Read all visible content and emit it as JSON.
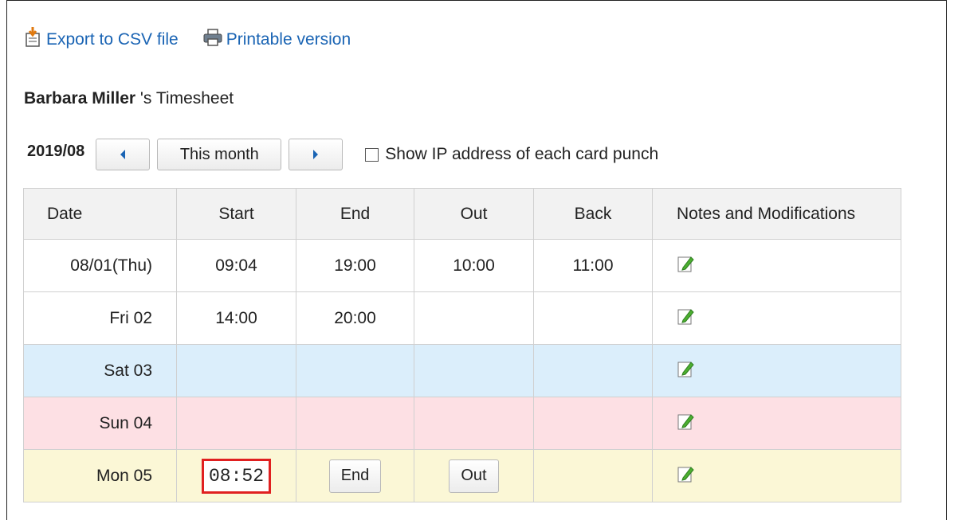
{
  "toolbar": {
    "export_label": "Export to CSV file",
    "print_label": "Printable version"
  },
  "heading": {
    "user": "Barbara Miller",
    "suffix": " 's Timesheet"
  },
  "nav": {
    "month": "2019/08",
    "this_month_label": "This month",
    "show_ip_label": "Show IP address of each card punch"
  },
  "table": {
    "headers": [
      "Date",
      "Start",
      "End",
      "Out",
      "Back",
      "Notes and Modifications"
    ],
    "rows": [
      {
        "date": "08/01(Thu)",
        "start": "09:04",
        "end": "19:00",
        "out": "10:00",
        "back": "11:00"
      },
      {
        "date": "Fri 02",
        "start": "14:00",
        "end": "20:00",
        "out": "",
        "back": ""
      },
      {
        "date": "Sat 03",
        "start": "",
        "end": "",
        "out": "",
        "back": ""
      },
      {
        "date": "Sun 04",
        "start": "",
        "end": "",
        "out": "",
        "back": ""
      },
      {
        "date": "Mon 05",
        "start": "08:52",
        "end_button": "End",
        "out_button": "Out",
        "back": ""
      }
    ]
  },
  "colors": {
    "link": "#1a64b4",
    "saturday": "#dbeefb",
    "sunday": "#fde0e4",
    "today": "#fbf7d6",
    "highlight": "#e02020"
  }
}
